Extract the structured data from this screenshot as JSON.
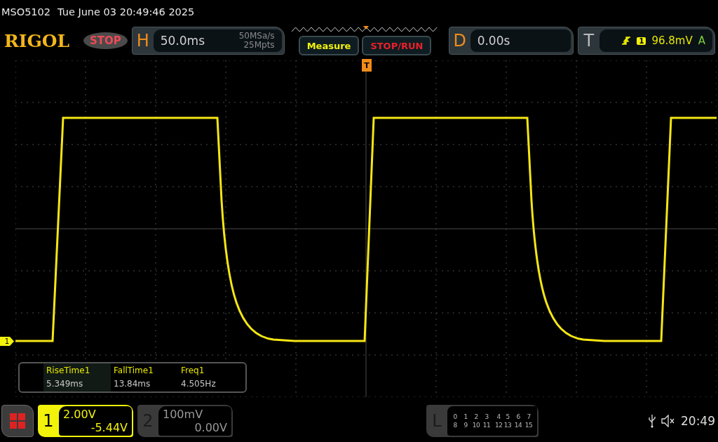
{
  "header": {
    "model": "MSO5102",
    "datetime": "Tue June 03 20:49:46 2025"
  },
  "toolbar": {
    "logo": "RIGOL",
    "run_state": "STOP",
    "horizontal": {
      "label": "H",
      "scale": "50.0ms",
      "sample_rate": "50MSa/s",
      "memory": "25Mpts"
    },
    "buttons": [
      {
        "label": "Measure",
        "kind": "function"
      },
      {
        "label": "STOP/RUN",
        "kind": "runstop"
      }
    ],
    "delay": {
      "label": "D",
      "value": "0.00s"
    },
    "trigger": {
      "label": "T",
      "channel": "1",
      "level": "96.8mV",
      "mode": "A"
    }
  },
  "screen": {
    "trigger_marker": "T",
    "channel_marker": "1",
    "measurements": [
      {
        "name": "RiseTime1",
        "value": "5.349ms",
        "selected": true
      },
      {
        "name": "FallTime1",
        "value": "13.84ms",
        "selected": false
      },
      {
        "name": "Freq1",
        "value": "4.505Hz",
        "selected": false
      }
    ]
  },
  "channels": [
    {
      "number": "1",
      "scale": "2.00V",
      "offset": "-5.44V",
      "selected": true
    },
    {
      "number": "2",
      "scale": "100mV",
      "offset": "0.00V",
      "selected": false
    }
  ],
  "logic": {
    "label": "L",
    "rows": [
      [
        "0",
        "1",
        "2",
        "3",
        "4",
        "5",
        "6",
        "7"
      ],
      [
        "8",
        "9",
        "10",
        "11",
        "12",
        "13",
        "14",
        "15"
      ]
    ]
  },
  "status": {
    "time": "20:49"
  }
}
